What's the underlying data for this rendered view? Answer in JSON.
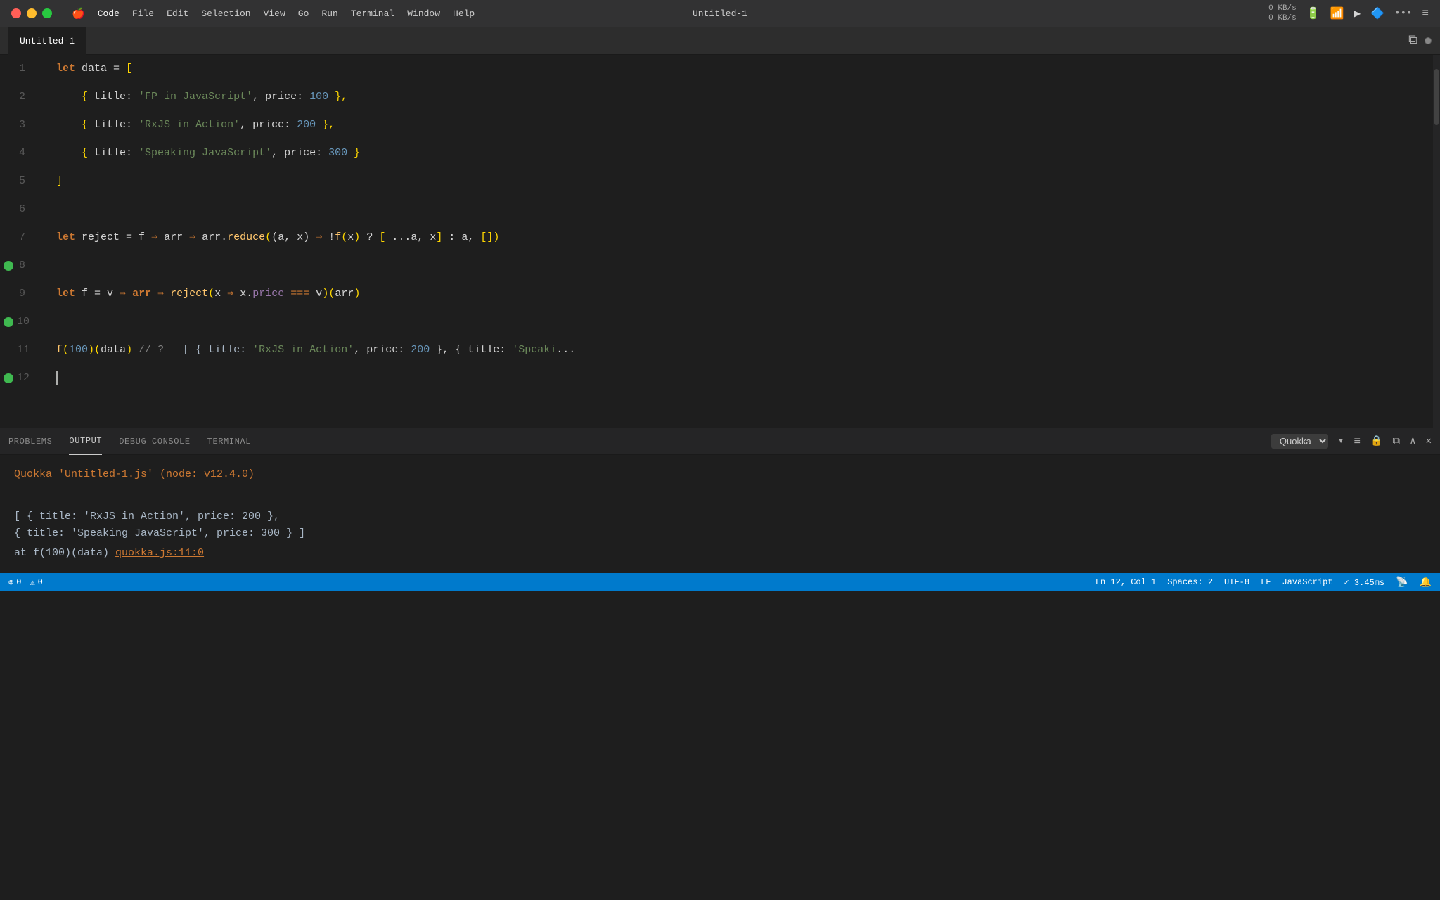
{
  "titlebar": {
    "title": "Untitled-1",
    "menu_items": [
      "Code",
      "File",
      "Edit",
      "Selection",
      "View",
      "Go",
      "Run",
      "Terminal",
      "Window",
      "Help"
    ],
    "battery_top": "0 KB/s",
    "battery_bottom": "0 KB/s"
  },
  "tab": {
    "label": "Untitled-1",
    "split_label": "⊞"
  },
  "code": {
    "line1_partial": "let data = [",
    "line2": "  { title: 'FP in JavaScript', price: 100 },",
    "line3": "  { title: 'RxJS in Action', price: 200 },",
    "line4": "  { title: 'Speaking JavaScript', price: 300 }",
    "line5": "]",
    "line6": "",
    "line7": "let reject = f => arr => arr.reduce((a, x) => !f(x) ? [ ...a, x] : a, [])",
    "line8": "",
    "line9": "let f = v => arr => reject(x => x.price === v)(arr)",
    "line10": "",
    "line11": "f(100)(data) // ?  [ { title: 'RxJS in Action', price: 200 }, { title: 'Speaki..."
  },
  "panel": {
    "tabs": [
      "PROBLEMS",
      "OUTPUT",
      "DEBUG CONSOLE",
      "TERMINAL"
    ],
    "active_tab": "OUTPUT",
    "dropdown_value": "Quokka",
    "output_header": "Quokka 'Untitled-1.js' (node: v12.4.0)",
    "output_line1": "[ { title: 'RxJS in Action', price: 200 },",
    "output_line2": "  { title: 'Speaking JavaScript', price: 300 } ]",
    "output_line3_prefix": "  at f(100)(data) ",
    "output_link": "quokka.js:11:0"
  },
  "statusbar": {
    "errors": "0",
    "warnings": "0",
    "ln": "Ln 12, Col 1",
    "spaces": "Spaces: 2",
    "encoding": "UTF-8",
    "eol": "LF",
    "language": "JavaScript",
    "perf": "✓ 3.45ms"
  },
  "icons": {
    "close": "✕",
    "minimize": "⊟",
    "maximize": "⊞",
    "split": "⬜",
    "dot": "●",
    "chevron_down": "▾",
    "bell": "🔔",
    "person": "👤",
    "error": "⊗",
    "warning": "⚠",
    "list": "≡",
    "lock": "🔒",
    "copy": "⧉",
    "up": "∧",
    "close_panel": "✕"
  }
}
